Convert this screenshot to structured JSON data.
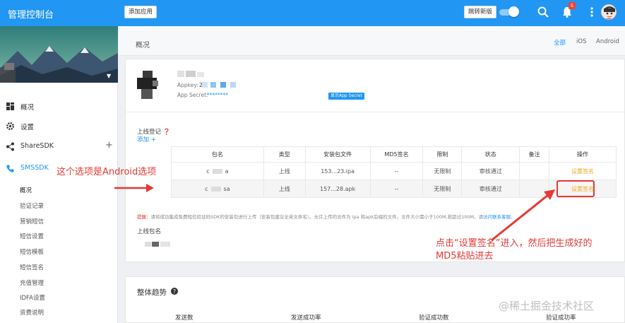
{
  "topbar": {
    "brand": "管理控制台",
    "add_app": "添加应用",
    "jump_new": "跳转新版",
    "notification_count": "5",
    "brand_color": "#2196f3"
  },
  "sidebar": {
    "nav": [
      {
        "label": "概况",
        "icon": "grid-icon"
      },
      {
        "label": "设置",
        "icon": "gear-icon"
      },
      {
        "label": "ShareSDK",
        "icon": "share-icon",
        "expandable": true
      },
      {
        "label": "SMSSDK",
        "icon": "phone-icon",
        "active": true
      }
    ],
    "sub_items": [
      "概况",
      "验证记录",
      "营销短信",
      "短信设置",
      "短信模板",
      "短信签名",
      "充值管理",
      "IDFA设置",
      "资费说明"
    ],
    "expand_symbol": "+"
  },
  "header": {
    "title": "概况",
    "platform_tabs": [
      "全部",
      "iOS",
      "Android"
    ],
    "active_tab": "全部"
  },
  "app_info": {
    "appkey_label": "Appkey:",
    "appkey_value": "2",
    "secret_label": "App Secret:",
    "secret_value": "********",
    "show_secret": "显示App Secret"
  },
  "registration": {
    "title": "上线登记",
    "add_link": "添加 +",
    "columns": [
      "包名",
      "类型",
      "安装包文件",
      "MD5签名",
      "限制",
      "状态",
      "备注",
      "操作"
    ],
    "rows": [
      {
        "pkg_prefix": "c",
        "pkg_suffix": "a",
        "type": "上线",
        "file": "153...23.ipa",
        "md5": "--",
        "limit": "无限制",
        "status": "审核通过",
        "note": "",
        "action": "设置签名"
      },
      {
        "pkg_prefix": "c",
        "pkg_suffix": "sa",
        "type": "上线",
        "file": "157...28.apk",
        "md5": "--",
        "limit": "无限制",
        "status": "审核通过",
        "note": "",
        "action": "设置签名"
      }
    ],
    "tip_prefix": "提醒：",
    "tip_body": "请将成功集成免费短信验证码SDK的安装包进行上传（安装包建议全英文命名）。允许上传的文件为 ipa 和apk后缀的文件，文件大小需小于100M,若超过100M，请",
    "tip_link": "访问联系客服",
    "tip_end": "。",
    "online_pkg_label": "上线包名"
  },
  "trend": {
    "title": "整体趋势",
    "columns": [
      "发送数",
      "发送成功率",
      "验证成功数",
      "验证成功率"
    ]
  },
  "annotations": {
    "android_note": "这个选项是Android选项",
    "instruction_line1": "点击“设置签名”进入，然后把生成好的",
    "instruction_line2": "MD5粘贴进去",
    "color": "#e53935"
  },
  "watermark": "@稀土掘金技术社区"
}
